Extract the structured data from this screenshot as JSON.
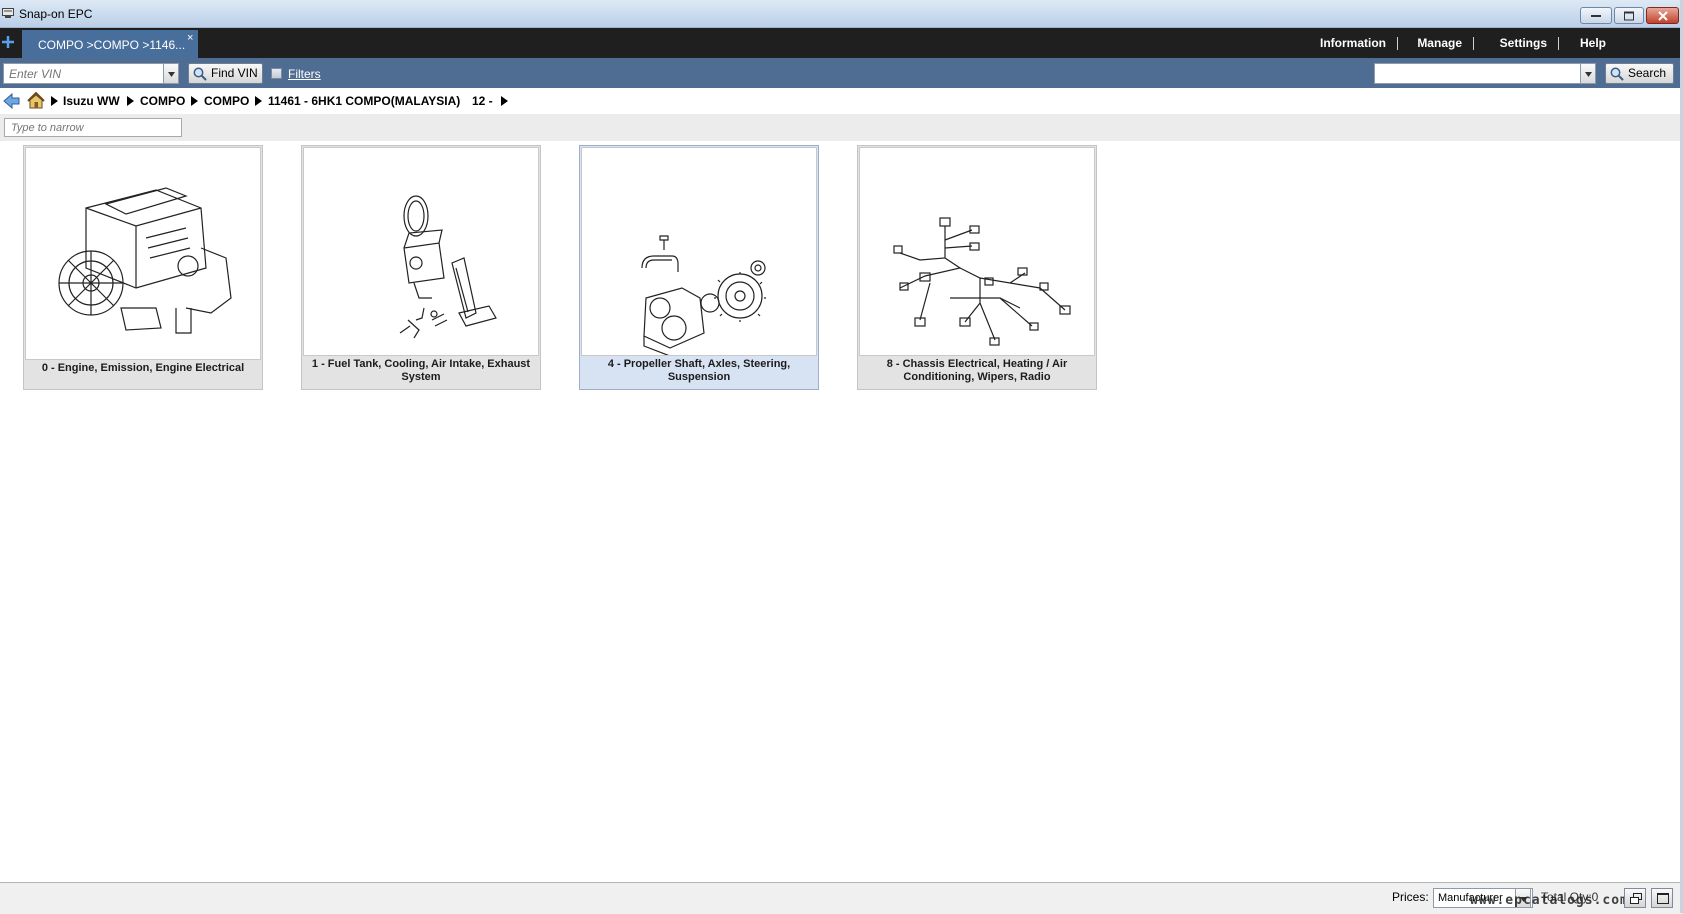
{
  "window": {
    "title": "Snap-on EPC"
  },
  "tabs": [
    {
      "label": "COMPO >COMPO >1146...",
      "close": "×"
    }
  ],
  "menu": [
    "Information",
    "Manage",
    "Settings",
    "Help"
  ],
  "toolbar": {
    "vin_placeholder": "Enter VIN",
    "find_vin_label": "Find VIN",
    "filters_label": "Filters",
    "search_label": "Search"
  },
  "breadcrumb": [
    "Isuzu WW",
    "COMPO",
    "COMPO",
    "11461 - 6HK1 COMPO(MALAYSIA)",
    "12 -"
  ],
  "narrow": {
    "placeholder": "Type to narrow"
  },
  "tiles": [
    {
      "caption": "0 - Engine, Emission, Engine Electrical",
      "icon": "engine-illustration",
      "selected": false
    },
    {
      "caption": "1 - Fuel Tank, Cooling, Air Intake, Exhaust System",
      "icon": "fuel-system-illustration",
      "selected": false
    },
    {
      "caption": "4 - Propeller Shaft, Axles, Steering, Suspension",
      "icon": "steering-pump-illustration",
      "selected": true
    },
    {
      "caption": "8 - Chassis Electrical, Heating / Air Conditioning, Wipers, Radio",
      "icon": "wiring-harness-illustration",
      "selected": false
    }
  ],
  "status": {
    "prices_label": "Prices:",
    "prices_value": "Manufacturer",
    "total_qty": "Total Qty:0",
    "watermark": "www.epcatalogs.com"
  },
  "colors": {
    "tab_active": "#486e9b",
    "toolbar": "#4f6d92",
    "tabbar": "#1f1f1f",
    "tile_selected": "#d7e3f3"
  }
}
